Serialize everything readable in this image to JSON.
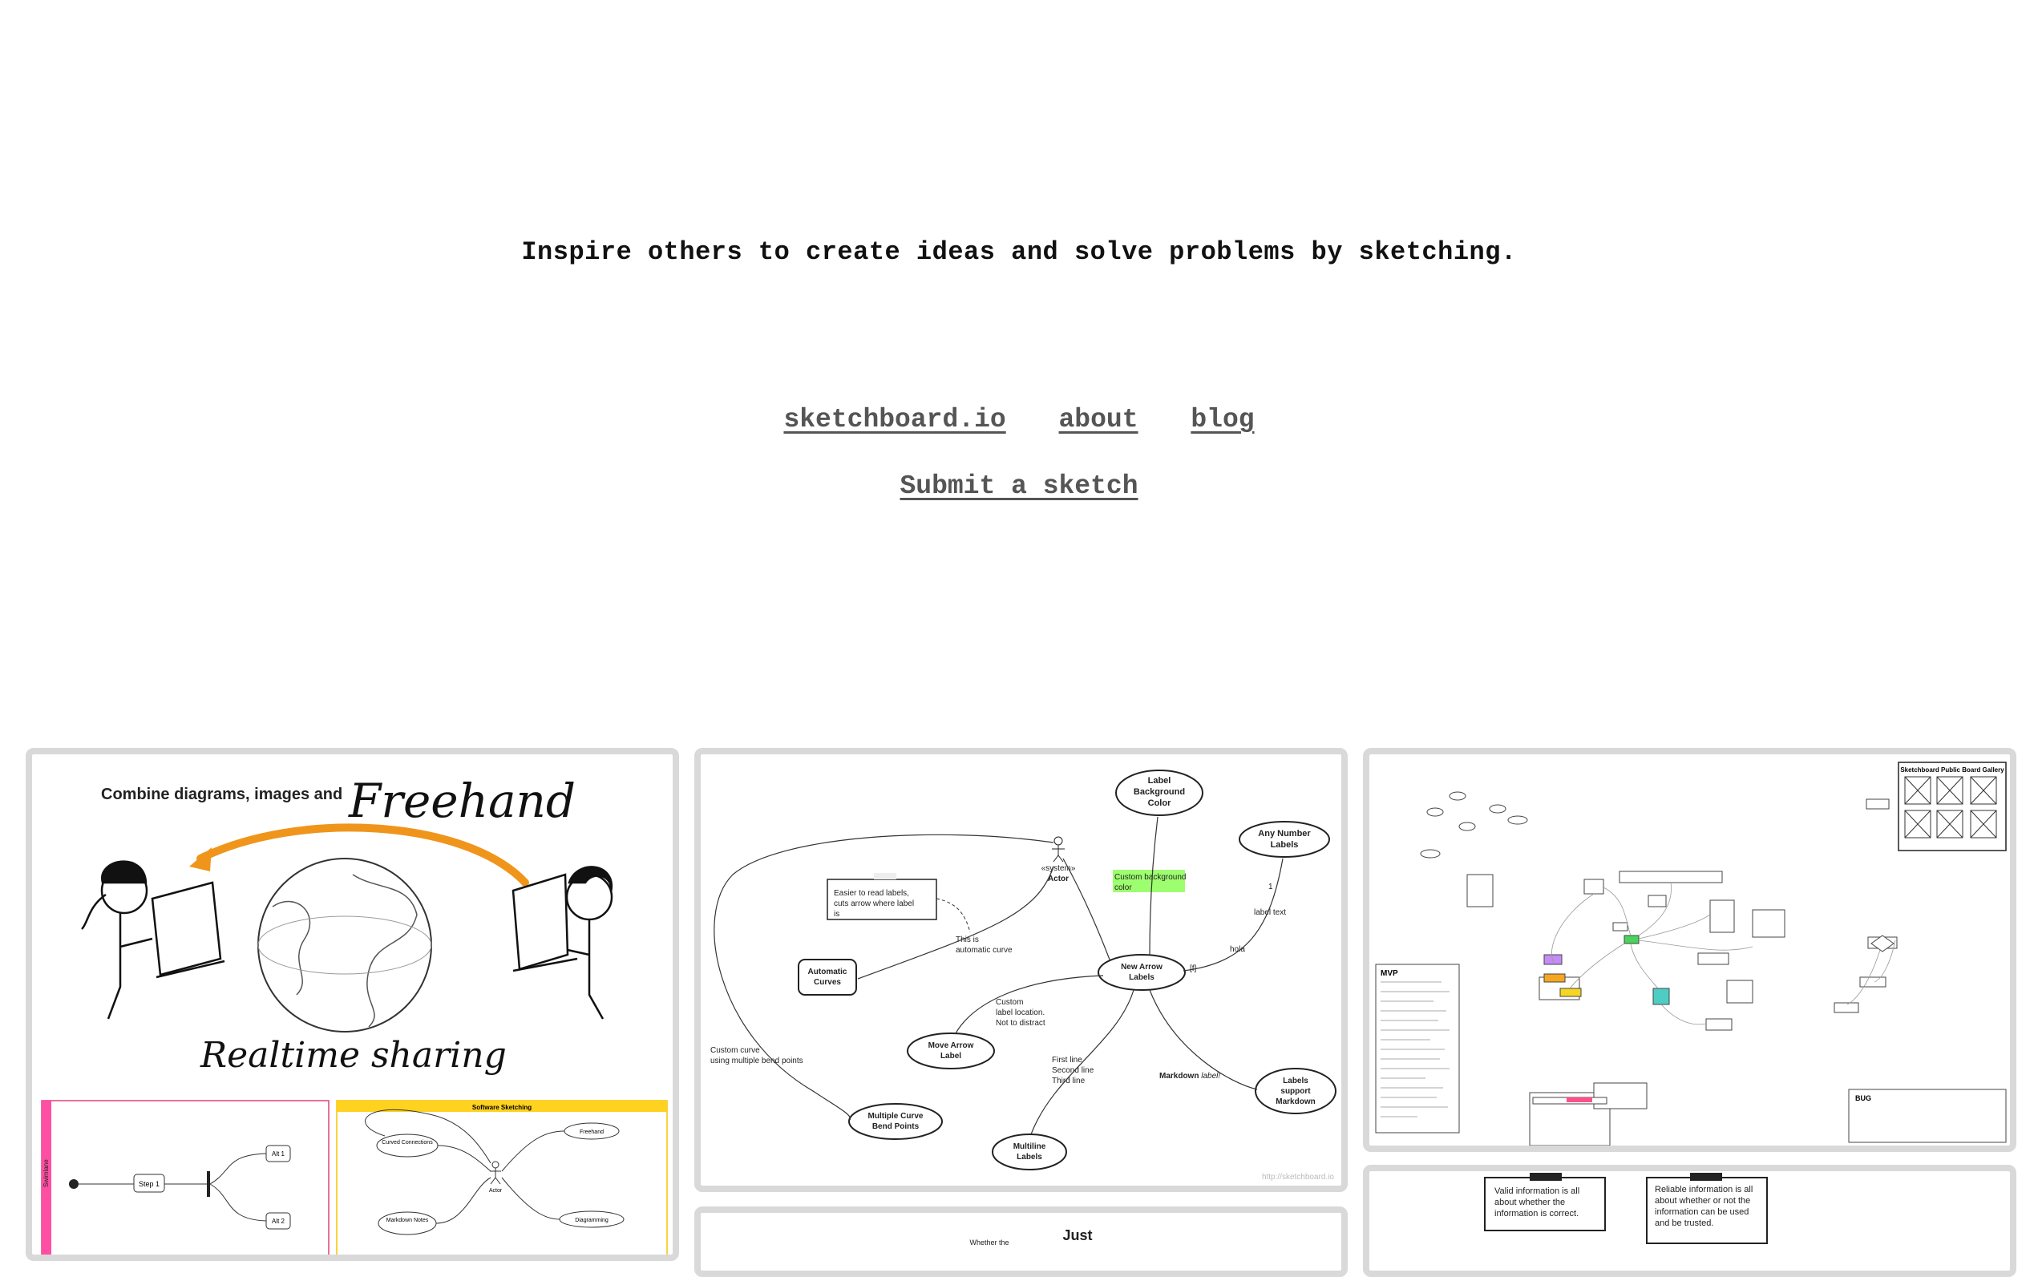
{
  "header": {
    "tagline": "Inspire others to create ideas and solve problems by sketching."
  },
  "nav": {
    "links": [
      "sketchboard.io",
      "about",
      "blog"
    ],
    "submit": "Submit a sketch"
  },
  "gallery": {
    "card1": {
      "title_prefix": "Combine diagrams, images and",
      "title_freehand": "Freehand",
      "subtitle": "Realtime sharing",
      "swimlane_label": "Swimlane",
      "flow_step": "Step 1",
      "flow_alt1": "Alt 1",
      "flow_alt2": "Alt 2",
      "software_header": "Software Sketching",
      "sw_curved": "Curved Connections",
      "sw_freehand": "Freehand",
      "sw_actor": "Actor",
      "sw_markdown": "Markdown Notes",
      "sw_diagramming": "Diagramming"
    },
    "card2": {
      "label_bg": "Label Background Color",
      "any_number": "Any Number Labels",
      "system_actor": "«system» Actor",
      "custom_bg": "Custom background color",
      "easier": "Easier to read labels, cuts arrow where label is",
      "automatic_curves": "Automatic Curves",
      "this_is": "This is automatic curve",
      "new_arrow": "New Arrow Labels",
      "label_text": "label text",
      "hola": "hola",
      "one": "1",
      "f_label": "[f]",
      "custom_loc": "Custom label location. Not to distract",
      "move_arrow": "Move Arrow Label",
      "custom_curve": "Custom curve using multiple bend points",
      "first_line": "First line",
      "second_line": "Second line",
      "third_line": "Third line",
      "markdown_label": "Markdown label!",
      "labels_support": "Labels support Markdown",
      "multiple_curve": "Multiple Curve Bend Points",
      "multiline": "Multiline Labels",
      "watermark": "http://sketchboard.io"
    },
    "card3": {
      "gallery_title": "Sketchboard Public Board Gallery",
      "mvp": "MVP",
      "bug": "BUG"
    },
    "card4": {
      "valid_info": "Valid information is all about whether the information is correct.",
      "reliable_info": "Reliable information is all about whether or not the information can be used and be trusted."
    },
    "card5": {
      "just": "Just",
      "whether": "Whether the"
    }
  }
}
